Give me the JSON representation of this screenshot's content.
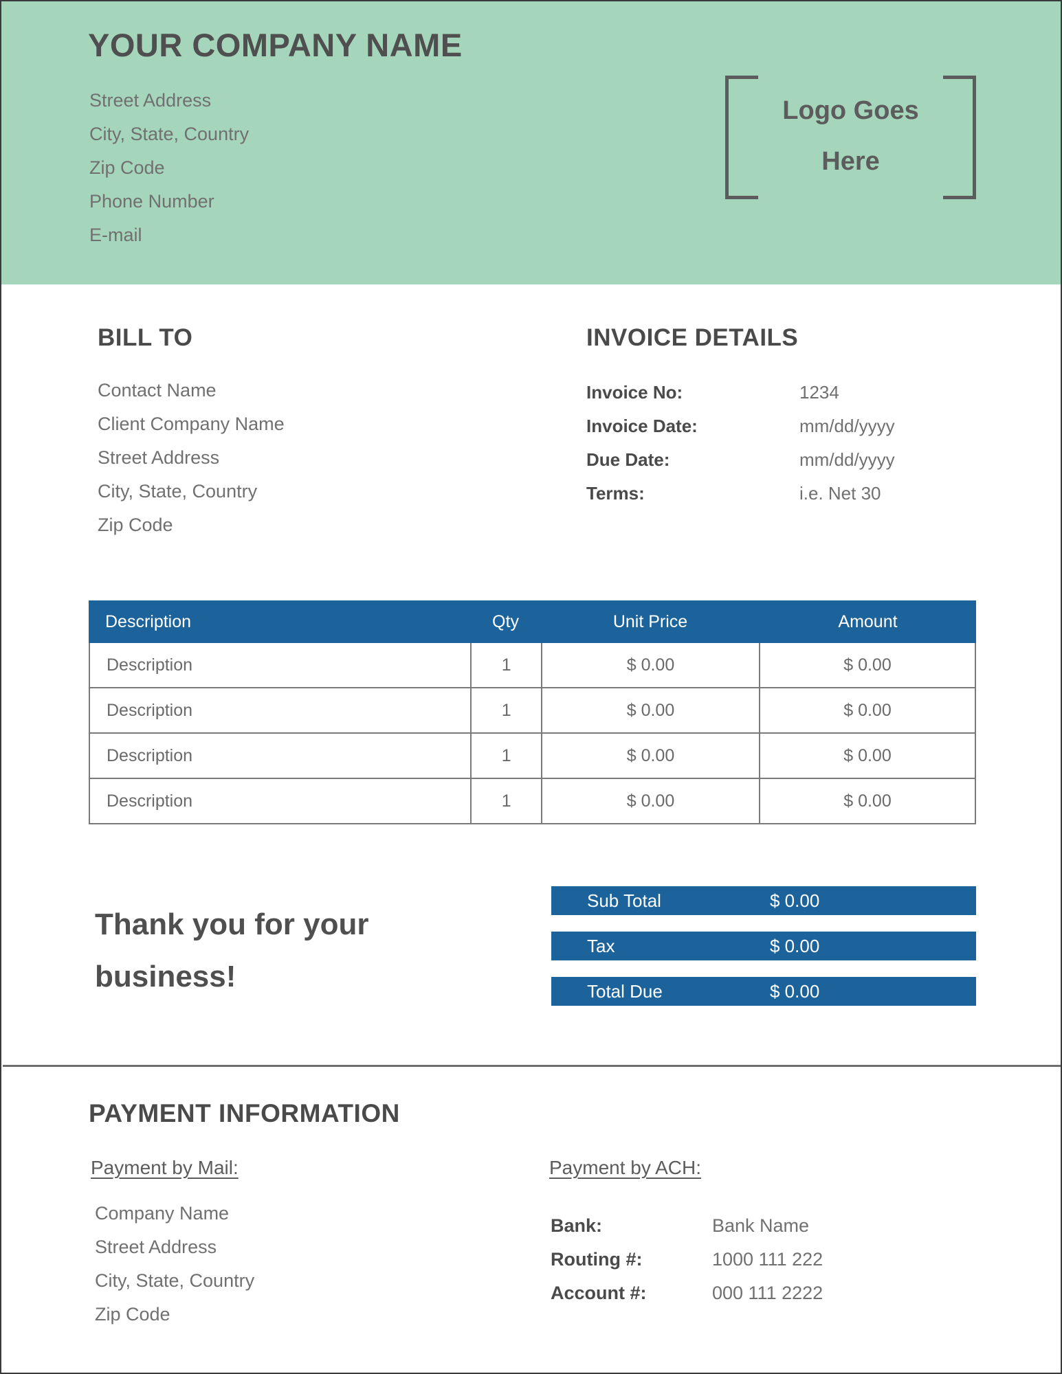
{
  "header": {
    "company_name": "YOUR COMPANY NAME",
    "address_lines": [
      "Street Address",
      "City, State, Country",
      "Zip Code",
      "Phone Number",
      "E-mail"
    ],
    "logo_line_1": "Logo Goes",
    "logo_line_2": "Here",
    "background_color": "#a5d6bb",
    "text_color": "#4f4f4f"
  },
  "bill_to": {
    "heading": "BILL TO",
    "lines": [
      "Contact Name",
      "Client Company Name",
      "Street Address",
      "City, State, Country",
      "Zip Code"
    ]
  },
  "invoice_details": {
    "heading": "INVOICE DETAILS",
    "rows": [
      {
        "label": "Invoice No:",
        "value": "1234"
      },
      {
        "label": "Invoice Date:",
        "value": "mm/dd/yyyy"
      },
      {
        "label": "Due Date:",
        "value": "mm/dd/yyyy"
      },
      {
        "label": "Terms:",
        "value": "i.e. Net 30"
      }
    ]
  },
  "items_table": {
    "accent_color": "#1c639b",
    "columns": [
      "Description",
      "Qty",
      "Unit Price",
      "Amount"
    ],
    "rows": [
      {
        "description": "Description",
        "qty": "1",
        "unit_price": "$ 0.00",
        "amount": "$ 0.00"
      },
      {
        "description": "Description",
        "qty": "1",
        "unit_price": "$ 0.00",
        "amount": "$ 0.00"
      },
      {
        "description": "Description",
        "qty": "1",
        "unit_price": "$ 0.00",
        "amount": "$ 0.00"
      },
      {
        "description": "Description",
        "qty": "1",
        "unit_price": "$ 0.00",
        "amount": "$ 0.00"
      }
    ]
  },
  "thank_you": "Thank you for your business!",
  "totals": [
    {
      "label": "Sub Total",
      "value": "$ 0.00"
    },
    {
      "label": "Tax",
      "value": "$ 0.00"
    },
    {
      "label": "Total Due",
      "value": "$ 0.00"
    }
  ],
  "payment_information": {
    "heading": "PAYMENT INFORMATION",
    "by_mail": {
      "title": "Payment by Mail:",
      "lines": [
        "Company Name",
        "Street Address",
        "City, State, Country",
        "Zip Code"
      ]
    },
    "by_ach": {
      "title": "Payment by ACH:",
      "rows": [
        {
          "label": "Bank:",
          "value": "Bank Name"
        },
        {
          "label": "Routing #:",
          "value": "1000 111 222"
        },
        {
          "label": "Account #:",
          "value": "000 111 2222"
        }
      ]
    }
  }
}
